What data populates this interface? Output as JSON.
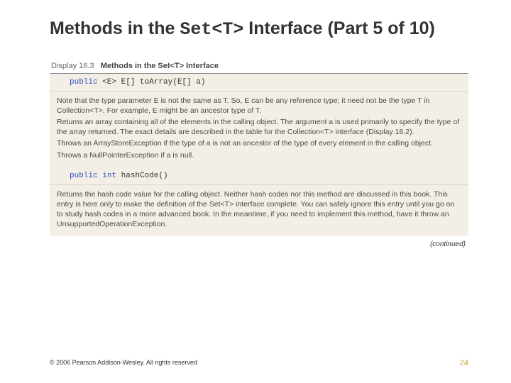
{
  "title": {
    "part1": "Methods in the ",
    "code": "Set<T>",
    "part2": " Interface (Part 5 of 10)"
  },
  "display": {
    "label": "Display 16.3",
    "title": "Methods in the Set<T> Interface"
  },
  "method1": {
    "kw1": "public",
    "sig_rest": " <E> E[] toArray(E[] a)",
    "desc": [
      "Note that the type parameter E is not the same as T. So, E can be any reference type; it need not be the type T in Collection<T>. For example, E might be an ancestor type of T.",
      "Returns an array containing all of the elements in the calling object. The argument a is used primarily to specify the type of the array returned. The exact details are described in the table for the Collection<T> interface (Display 16.2).",
      "Throws an ArrayStoreException if the type of a is not an ancestor of the type of every element in the calling object.",
      "Throws a NullPointerException if a is null."
    ]
  },
  "method2": {
    "kw1": "public",
    "kw2": "int",
    "sig_rest": " hashCode()",
    "desc": [
      "Returns the hash code value for the calling object. Neither hash codes nor this method are discussed in this book. This entry is here only to make the definition of the Set<T> interface complete. You can safely ignore this entry until you go on to study hash codes in a more advanced book. In the meantime, if you need to implement this method, have it throw an UnsupportedOperationException."
    ]
  },
  "continued": "(continued)",
  "footer": {
    "copyright": "© 2006 Pearson Addison-Wesley. All rights reserved",
    "page": "24"
  }
}
